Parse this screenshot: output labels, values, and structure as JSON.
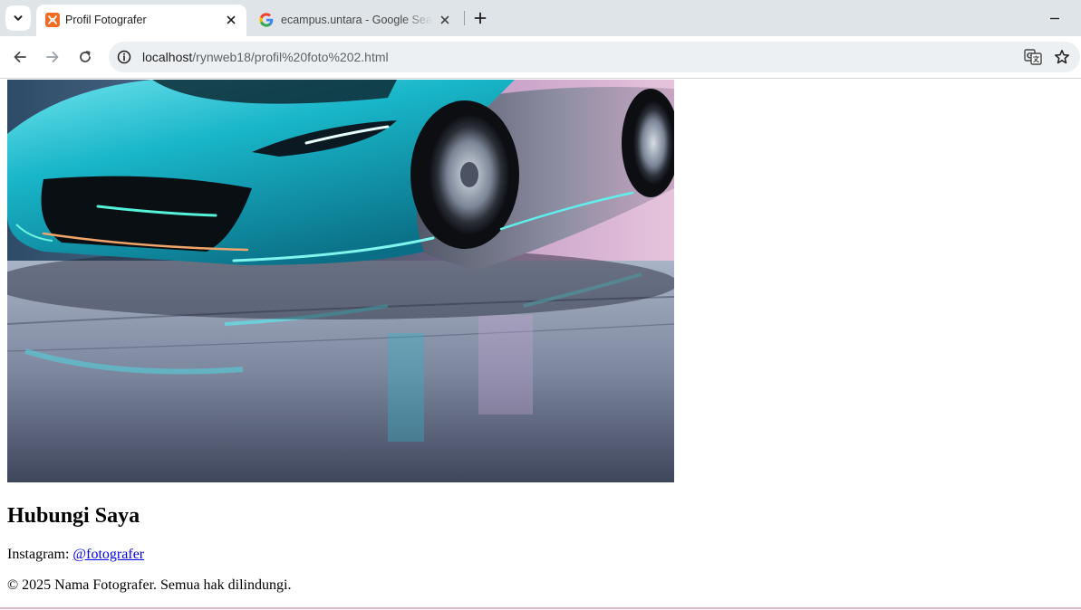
{
  "browser": {
    "tabs": [
      {
        "title": "Profil Fotografer",
        "active": true,
        "icon": "xampp-favicon-icon"
      },
      {
        "title": "ecampus.untara - Google Search",
        "active": false,
        "icon": "google-favicon-icon"
      }
    ],
    "address": {
      "host": "localhost",
      "path": "/rynweb18/profil%20foto%202.html"
    },
    "colors": {
      "tabstrip": "#dfe4e8",
      "omnibox": "#edf0f3",
      "favicon_orange": "#f26b22"
    }
  },
  "page": {
    "photo_icon": "car-photo-image",
    "contact_heading": "Hubungi Saya",
    "instagram_label": "Instagram: ",
    "instagram_handle": "@fotografer",
    "footer": "© 2025 Nama Fotografer. Semua hak dilindungi.",
    "colors": {
      "link": "#0000ee",
      "car_body": "#19b6c9"
    }
  }
}
